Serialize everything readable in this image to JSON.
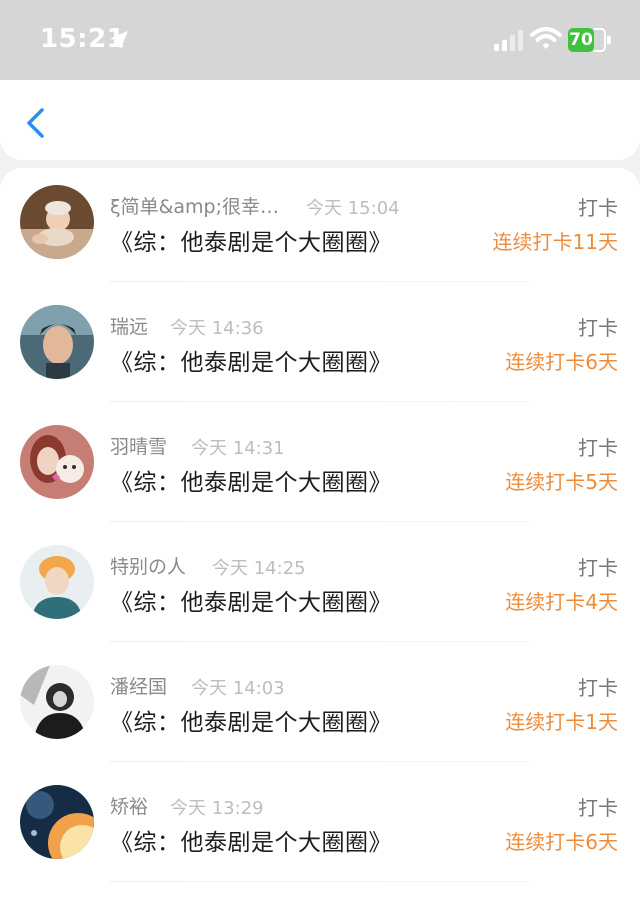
{
  "status_bar": {
    "time": "15:21",
    "battery_level": "70",
    "battery_color": "#3fc33f",
    "icons": [
      "location-arrow-icon",
      "cellular-signal-icon",
      "wifi-icon",
      "battery-icon"
    ]
  },
  "nav": {
    "back_icon": "chevron-left-icon",
    "accent": "#2b8ff0"
  },
  "accent_streak_color": "#ef8c3a",
  "items": [
    {
      "name": "ξ简单&amp;很幸…",
      "time": "今天 15:04",
      "title": "《综：他泰剧是个大圈圈》",
      "action": "打卡",
      "streak": "连续打卡11天"
    },
    {
      "name": "瑞远",
      "time": "今天 14:36",
      "title": "《综：他泰剧是个大圈圈》",
      "action": "打卡",
      "streak": "连续打卡6天"
    },
    {
      "name": "羽晴雪",
      "time": "今天 14:31",
      "title": "《综：他泰剧是个大圈圈》",
      "action": "打卡",
      "streak": "连续打卡5天"
    },
    {
      "name": "特别の人",
      "time": "今天 14:25",
      "title": "《综：他泰剧是个大圈圈》",
      "action": "打卡",
      "streak": "连续打卡4天"
    },
    {
      "name": "潘经国",
      "time": "今天 14:03",
      "title": "《综：他泰剧是个大圈圈》",
      "action": "打卡",
      "streak": "连续打卡1天"
    },
    {
      "name": "矫裕",
      "time": "今天 13:29",
      "title": "《综：他泰剧是个大圈圈》",
      "action": "打卡",
      "streak": "连续打卡6天"
    }
  ]
}
